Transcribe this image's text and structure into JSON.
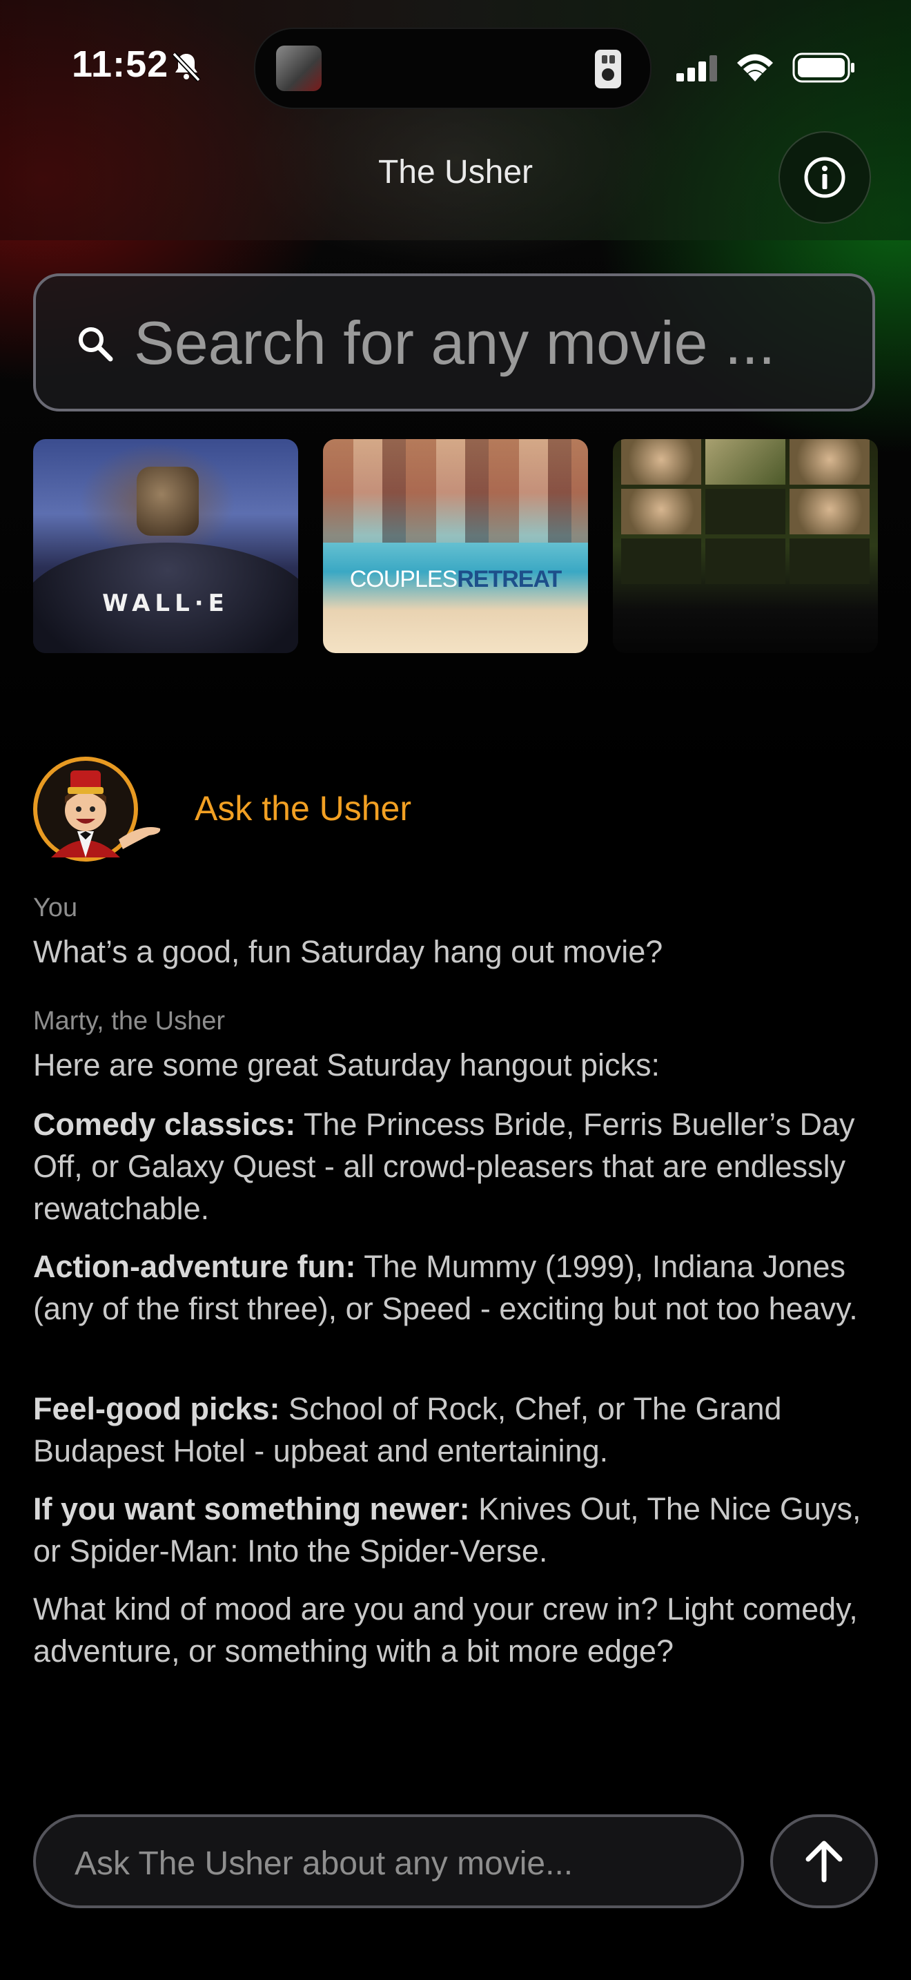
{
  "status_bar": {
    "time": "11:52"
  },
  "header": {
    "title": "The Usher"
  },
  "search": {
    "placeholder": "Search for any movie ..."
  },
  "posters": [
    {
      "title": "WALL·E"
    },
    {
      "title_part1": "COUPLES",
      "title_part2": "RETREAT"
    },
    {
      "title": ""
    }
  ],
  "chat": {
    "heading": "Ask the Usher",
    "messages": [
      {
        "speaker": "You",
        "text": "What’s a good, fun Saturday hang out movie?"
      },
      {
        "speaker": "Marty, the Usher",
        "intro": "Here are some great Saturday hangout picks:",
        "sections": [
          {
            "label": "Comedy classics:",
            "text": " The Princess Bride, Ferris Bueller’s Day Off, or Galaxy Quest - all crowd-pleasers that are endlessly rewatchable."
          },
          {
            "label": "Action-adventure fun:",
            "text": " The Mummy (1999), Indiana Jones (any of the first three), or Speed - exciting but not too heavy."
          },
          {
            "label": "Feel-good picks:",
            "text": " School of Rock, Chef, or The Grand Budapest Hotel - upbeat and entertaining."
          },
          {
            "label": "If you want something newer:",
            "text": " Knives Out, The Nice Guys, or Spider-Man: Into the Spider-Verse."
          }
        ],
        "closing": "What kind of mood are you and your crew in? Light comedy, adventure, or something with a bit more edge?"
      }
    ],
    "input_placeholder": "Ask The Usher about any movie..."
  },
  "colors": {
    "accent": "#f2a023",
    "background": "#000000"
  }
}
